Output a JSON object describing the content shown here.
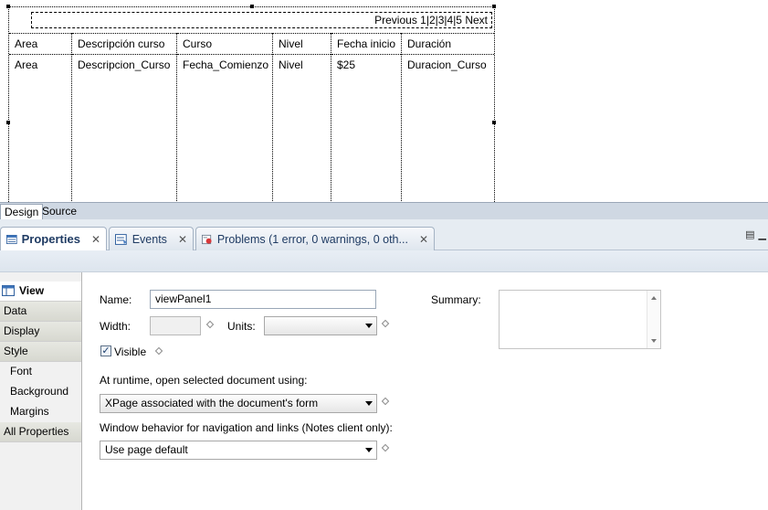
{
  "design": {
    "pager": "Previous 1|2|3|4|5 Next",
    "columns": [
      {
        "header": "Area",
        "value": "Area"
      },
      {
        "header": "Descripción  curso",
        "value": "Descripcion_Curso"
      },
      {
        "header": "Curso",
        "value": "Fecha_Comienzo"
      },
      {
        "header": "Nivel",
        "value": "Nivel"
      },
      {
        "header": "Fecha  inicio",
        "value": "$25"
      },
      {
        "header": "Duración",
        "value": "Duracion_Curso"
      }
    ]
  },
  "editor_tabs": {
    "design": "Design",
    "source": "Source"
  },
  "view_tabs": {
    "properties": "Properties",
    "events": "Events",
    "problems": "Problems (1 error, 0 warnings, 0 oth..."
  },
  "side_nav": {
    "view": "View",
    "data": "Data",
    "display": "Display",
    "style": "Style",
    "font": "Font",
    "background": "Background",
    "margins": "Margins",
    "all_properties": "All Properties"
  },
  "form": {
    "name_label": "Name:",
    "name_value": "viewPanel1",
    "width_label": "Width:",
    "width_value": "",
    "units_label": "Units:",
    "units_value": "",
    "visible_label": "Visible",
    "visible_checked": true,
    "runtime_label": "At runtime, open selected document using:",
    "runtime_value": "XPage associated with the document's form",
    "window_label": "Window behavior for navigation and links (Notes client only):",
    "window_value": "Use page default",
    "summary_label": "Summary:",
    "summary_value": ""
  }
}
